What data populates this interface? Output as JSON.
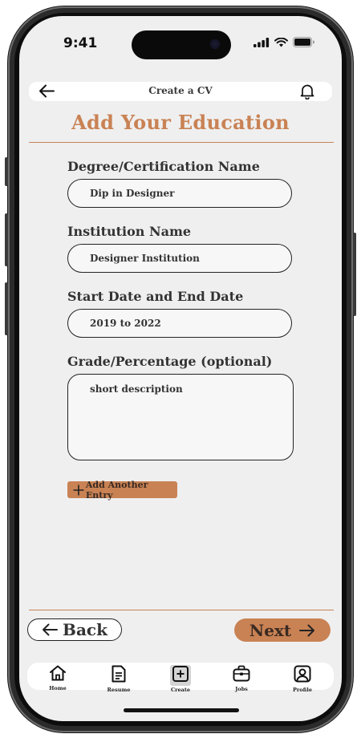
{
  "status": {
    "time": "9:41"
  },
  "appbar": {
    "title": "Create a CV"
  },
  "page": {
    "title": "Add Your Education"
  },
  "form": {
    "degree": {
      "label": "Degree/Certification Name",
      "value": "Dip in Designer"
    },
    "institution": {
      "label": "Institution Name",
      "value": "Designer Institution"
    },
    "dates": {
      "label": "Start Date and End Date",
      "value": "2019 to 2022"
    },
    "grade": {
      "label": "Grade/Percentage (optional)",
      "value": "short description"
    },
    "add_entry_label": "Add Another Entry"
  },
  "actions": {
    "back_label": "Back",
    "next_label": "Next"
  },
  "nav": {
    "items": [
      {
        "label": "Home",
        "icon": "home-icon"
      },
      {
        "label": "Resume",
        "icon": "document-icon"
      },
      {
        "label": "Create",
        "icon": "plus-square-icon",
        "active": true
      },
      {
        "label": "Jobs",
        "icon": "briefcase-icon"
      },
      {
        "label": "Profile",
        "icon": "user-square-icon"
      }
    ]
  },
  "colors": {
    "accent": "#c98254",
    "background": "#efefef",
    "text": "#333333"
  }
}
